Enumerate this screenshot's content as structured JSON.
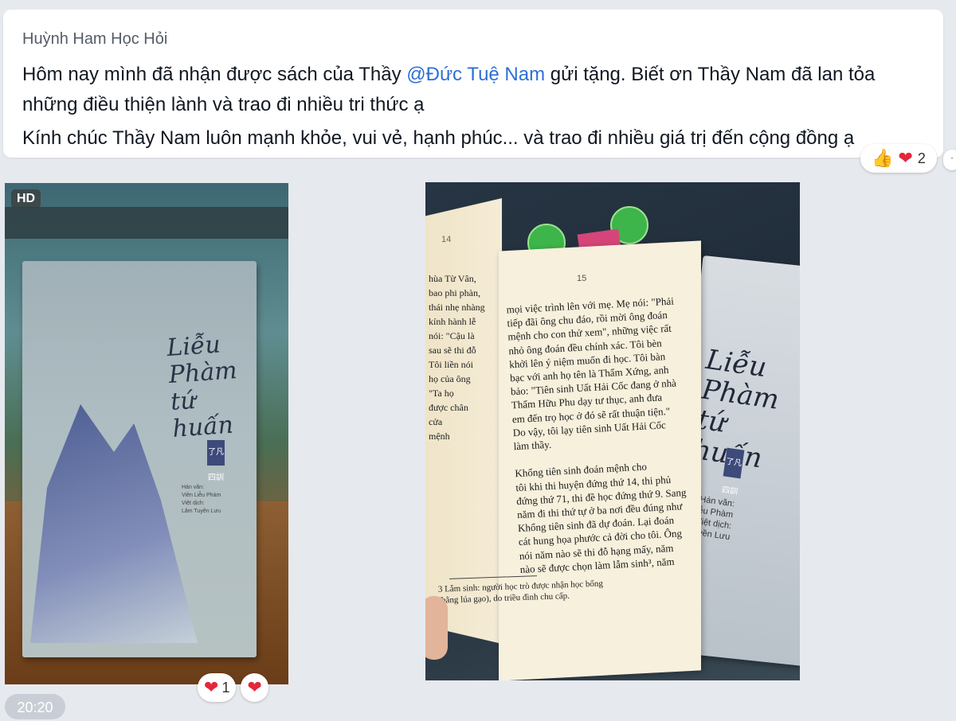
{
  "message": {
    "sender": "Huỳnh Ham Học Hỏi",
    "line1_before": "Hôm nay mình đã nhận được sách của Thầy ",
    "mention": "@Đức Tuệ Nam",
    "line1_after": " gửi tặng. Biết ơn Thầy Nam đã lan tỏa",
    "line2": "những điều thiện lành và trao đi nhiều tri thức ạ",
    "line3": "Kính chúc Thầy Nam luôn mạnh khỏe, vui vẻ, hạnh phúc... và trao đi nhiều giá trị đến cộng đồng ạ",
    "reaction_count": "2"
  },
  "photo1": {
    "badge": "HD",
    "cover_title": [
      "Liễu",
      "Phàm",
      "tứ",
      "huấn"
    ],
    "seal": "了凡四訓",
    "small_lines": [
      "Hán văn:",
      "Viên Liễu Phàm",
      "Việt dịch:",
      "Lâm Tuyền Lưu"
    ],
    "reaction_count": "1",
    "time": "20:20"
  },
  "photo2": {
    "left_page_number": "14",
    "left_page_lines": [
      "hùa Từ Vân,",
      "bao phi phàn,",
      "thái nhẹ nhàng",
      "kính hành lễ",
      "nói: \"Cậu là",
      "sau sẽ thi đỗ",
      "Tôi liền nói",
      "họ của ông",
      "\"Ta họ",
      "được chân",
      "cửa",
      "mệnh"
    ],
    "page_number": "15",
    "page_lines": [
      "mọi việc trình lên với mẹ. Mẹ nói: \"Phải",
      "tiếp đãi ông chu đáo, rồi mời ông đoán",
      "mệnh cho con thử xem\", những việc rất",
      "nhỏ ông đoán đều chính xác. Tôi bèn",
      "khởi lên ý niệm muốn đi học. Tôi bàn",
      "bạc với anh họ tên là Thẩm Xứng, anh",
      "bảo: \"Tiên sinh Uất Hải Cốc đang ở nhà",
      "Thẩm Hữu Phu dạy tư thục, anh đưa",
      "em đến trọ học ở đó sẽ rất thuận tiện.\"",
      "Do vậy, tôi lạy tiên sinh Uất Hải Cốc",
      "làm thầy.",
      "",
      "Khổng tiên sinh đoán mệnh cho",
      "tôi khi thi huyện đứng thứ 14, thi phủ",
      "đứng thứ 71, thi đề học đứng thứ 9. Sang",
      "năm đi thi thứ tự ở ba nơi đều đúng như",
      "Khổng tiên sinh đã dự đoán. Lại đoán",
      "cát hung họa phước cả đời cho tôi. Ông",
      "nói năm nào sẽ thi đỗ hạng mấy, năm",
      "nào sẽ được chọn làm lẫm sinh³, năm"
    ],
    "footnote": [
      "3  Lẫm sinh: người học trò được nhận học bổng",
      "(bằng lúa gạo), do triều đình chu cấp."
    ],
    "cover_title": [
      "Liễu",
      "Phàm",
      "tứ",
      "huấn"
    ],
    "seal": "了凡四訓",
    "small_lines": [
      "Hán văn:",
      "Viên Liễu Phàm",
      "Việt dịch:",
      "Lâm Tuyền Lưu"
    ]
  },
  "icons": {
    "like": "thumbs-up-icon",
    "love": "heart-icon"
  }
}
